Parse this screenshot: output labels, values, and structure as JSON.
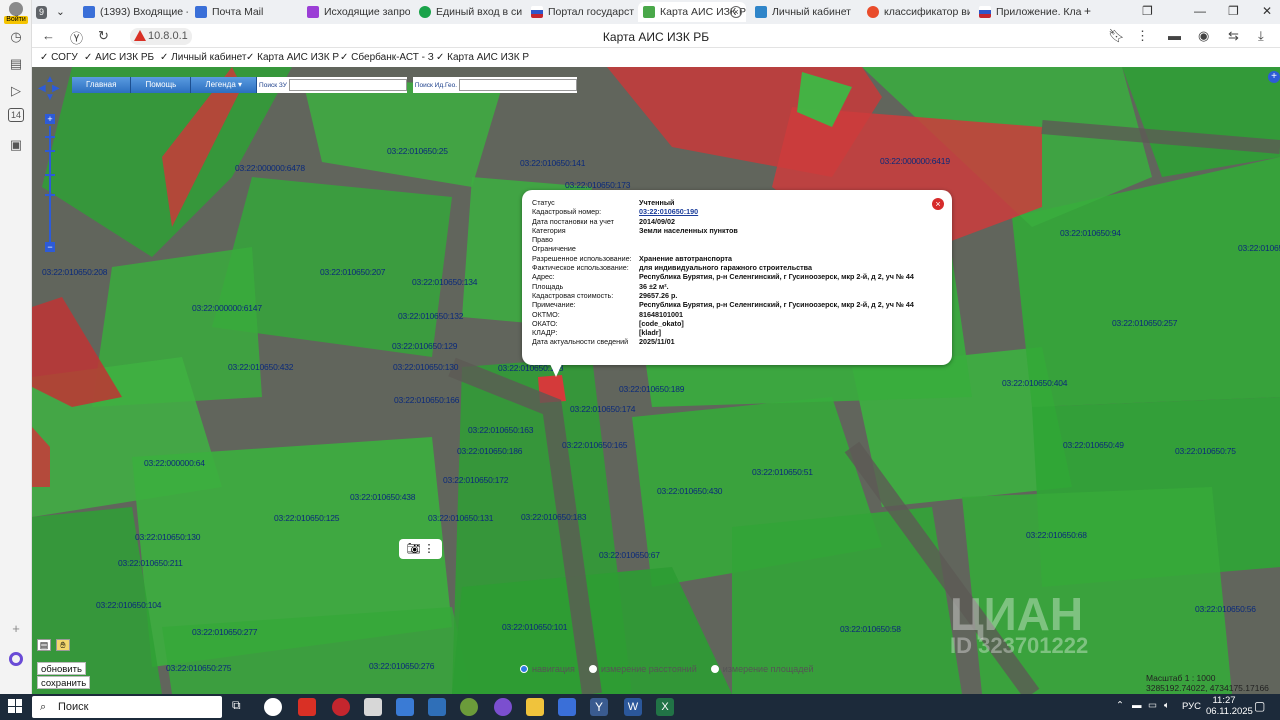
{
  "sidebar": {
    "avatar_label": "Войти",
    "items": [
      "clock-icon",
      "pages-icon",
      "play-icon",
      "14",
      "copy-icon",
      "plus-icon",
      "circle-icon"
    ]
  },
  "tabs": [
    {
      "label": "9",
      "color": "#5f6368"
    },
    {
      "label": "(1393) Входящие - ",
      "color": "#3a6fd8"
    },
    {
      "label": "Почта Mail",
      "color": "#3a6fd8"
    },
    {
      "label": "Исходящие запросы",
      "color": "#9b3ed6"
    },
    {
      "label": "Единый вход в систе",
      "color": "#1aa34a"
    },
    {
      "label": "Портал государстве",
      "color": "#c4262e"
    },
    {
      "label": "Карта АИС ИЗК Р",
      "color": "#4aa84a"
    },
    {
      "label": "Личный кабинет",
      "color": "#2f85c9"
    },
    {
      "label": "классификатор вид",
      "color": "#e94c2b"
    },
    {
      "label": "Приложение. Класс",
      "color": "#c4262e"
    }
  ],
  "address": {
    "ip": "10.8.0.1",
    "page_title": "Карта АИС ИЗК РБ"
  },
  "bookmarks": [
    "СОГУ",
    "АИС ИЗК РБ",
    "Личный кабинет",
    "Карта АИС ИЗК Р",
    "Сбербанк-АСТ - З",
    "Карта АИС ИЗК Р"
  ],
  "map_toolbar": {
    "buttons": [
      "Главная",
      "Помощь",
      "Легенда"
    ],
    "search_zu": "Поиск ЗУ",
    "search_id": "Поиск Ид.Гео."
  },
  "popup": {
    "rows": [
      {
        "k": "Статус",
        "v": "Учтенный"
      },
      {
        "k": "Кадастровый номер:",
        "v": "03:22:010650:190",
        "link": true
      },
      {
        "k": "Дата постановки на учет",
        "v": "2014/09/02"
      },
      {
        "k": "Категория",
        "v": "Земли населенных пунктов"
      },
      {
        "k": "Право",
        "v": ""
      },
      {
        "k": "Ограничение",
        "v": ""
      },
      {
        "k": "Разрешенное использование:",
        "v": "Хранение автотранспорта"
      },
      {
        "k": "Фактическое использование:",
        "v": "для индивидуального гаражного строительства"
      },
      {
        "k": "Адрес:",
        "v": "Республика Бурятия, р-н Селенгинский, г Гусиноозерск, мкр 2-й, д 2, уч № 44"
      },
      {
        "k": "Площадь",
        "v": "36 ±2 м²."
      },
      {
        "k": "Кадастровая стоимость:",
        "v": "29657.26 р."
      },
      {
        "k": "Примечание:",
        "v": "Республика Бурятия, р-н Селенгинский, г Гусиноозерск, мкр 2-й, д 2, уч № 44"
      },
      {
        "k": "ОКТМО:",
        "v": "81648101001"
      },
      {
        "k": "ОКАТО:",
        "v": "[code_okato]"
      },
      {
        "k": "КЛАДР:",
        "v": "[kladr]"
      },
      {
        "k": "Дата актуальности сведений",
        "v": "2025/11/01"
      }
    ]
  },
  "parcels": [
    {
      "t": "03:22:010650:25"
    },
    {
      "t": "03:22:000000:6478"
    },
    {
      "t": "03:22:010650:141"
    },
    {
      "t": "03:22:010650:173"
    },
    {
      "t": "03:22:000000:6419"
    },
    {
      "t": "03:22:010650:94"
    },
    {
      "t": "03:22:010650:207"
    },
    {
      "t": "03:22:010650:134"
    },
    {
      "t": "03:22:000000:6147"
    },
    {
      "t": "03:22:010650:132"
    },
    {
      "t": "03:22:010650:129"
    },
    {
      "t": "03:22:010650:432"
    },
    {
      "t": "03:22:010650:130"
    },
    {
      "t": "03:22:010650:128"
    },
    {
      "t": "03:22:010650:166"
    },
    {
      "t": "03:22:010650:189"
    },
    {
      "t": "03:22:010650:174"
    },
    {
      "t": "03:22:010650:163"
    },
    {
      "t": "03:22:010650:165"
    },
    {
      "t": "03:22:010650:186"
    },
    {
      "t": "03:22:010650:172"
    },
    {
      "t": "03:22:000000:64"
    },
    {
      "t": "03:22:010650:438"
    },
    {
      "t": "03:22:010650:430"
    },
    {
      "t": "03:22:010650:51"
    },
    {
      "t": "03:22:010650:125"
    },
    {
      "t": "03:22:010650:131"
    },
    {
      "t": "03:22:010650:183"
    },
    {
      "t": "03:22:010650:130"
    },
    {
      "t": "03:22:010650:211"
    },
    {
      "t": "03:22:010650:67"
    },
    {
      "t": "03:22:010650:104"
    },
    {
      "t": "03:22:010650:277"
    },
    {
      "t": "03:22:010650:101"
    },
    {
      "t": "03:22:010650:58"
    },
    {
      "t": "03:22:010650:275"
    },
    {
      "t": "03:22:010650:276"
    },
    {
      "t": "03:22:010650:404"
    },
    {
      "t": "03:22:010650:49"
    },
    {
      "t": "03:22:010650:75"
    },
    {
      "t": "03:22:010650:68"
    },
    {
      "t": "03:22:010650:257"
    },
    {
      "t": "03:22:010650:93"
    },
    {
      "t": "03:22:010650:208"
    },
    {
      "t": "03:22:010650:56"
    }
  ],
  "map_controls": {
    "update_btn": "обновить",
    "save_btn": "сохранить",
    "radio_nav": "навигация",
    "radio_dist": "измерение расстояний",
    "radio_area": "измерение площадей",
    "scale_line1": "Масштаб 1 : 1000",
    "scale_line2": "3285192.74022, 4734175.17166",
    "watermark": "ЦИАН",
    "watermark_id": "ID 323701222"
  },
  "taskbar": {
    "search": "Поиск",
    "lang": "РУС",
    "time": "11:27",
    "date": "06.11.2025"
  }
}
